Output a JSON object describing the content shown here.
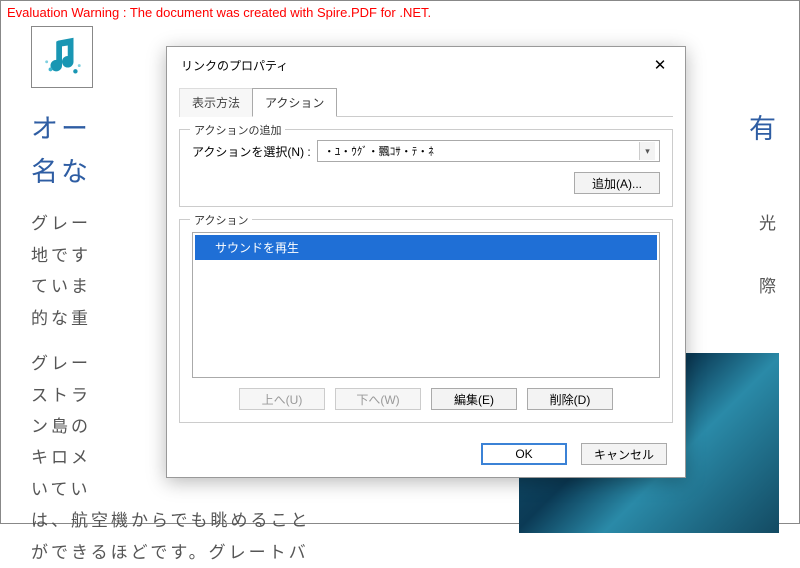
{
  "warning": "Evaluation Warning : The document was created with Spire.PDF for .NET.",
  "doc": {
    "title_frag1": "オー",
    "title_frag2": "有",
    "title_line2": "名な",
    "para1_frag1": "グレー",
    "para1_frag2": "光",
    "para1_line2": "地です",
    "para1_line3": "ていま",
    "para1_frag3": "際",
    "para1_line4": "的な重",
    "para2_line1": "グレー",
    "para2_line2": "ストラ",
    "para2_line3": "ン島の",
    "para2_line4": "キロメ",
    "para2_line5": "いてい",
    "para2_line6": "は、航空機からでも眺めること",
    "para2_line7": "ができるほどです。グレートバ"
  },
  "dialog": {
    "title": "リンクのプロパティ",
    "tabs": {
      "display": "表示方法",
      "actions": "アクション"
    },
    "add_group": {
      "legend": "アクションの追加",
      "select_label": "アクションを選択(N) :",
      "select_value": "・ﾕ・ｳｸﾞ・飄ｺｻ・ﾃ・ﾈ",
      "add_btn": "追加(A)..."
    },
    "list_group": {
      "legend": "アクション",
      "item": "サウンドを再生",
      "up": "上へ(U)",
      "down": "下へ(W)",
      "edit": "編集(E)",
      "delete": "削除(D)"
    },
    "footer": {
      "ok": "OK",
      "cancel": "キャンセル"
    }
  }
}
